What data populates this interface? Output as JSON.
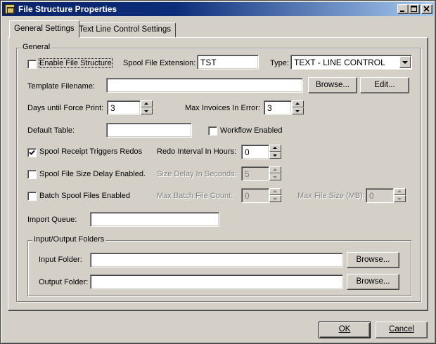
{
  "window": {
    "title": "File Structure Properties",
    "minimize_label": "_",
    "maximize_label": "□",
    "close_label": "×"
  },
  "tabs": [
    {
      "label": "General Settings",
      "active": true
    },
    {
      "label": "Text Line Control Settings",
      "active": false
    }
  ],
  "general": {
    "group_title": "General",
    "enable_file_structure": {
      "label": "Enable File Structure",
      "checked": false
    },
    "spool_file_extension": {
      "label": "Spool File Extension:",
      "value": "TST"
    },
    "type": {
      "label": "Type:",
      "value": "TEXT - LINE CONTROL"
    },
    "template_filename": {
      "label": "Template Filename:",
      "value": ""
    },
    "browse_label": "Browse...",
    "edit_label": "Edit...",
    "days_until_force_print": {
      "label": "Days until Force Print:",
      "value": "3"
    },
    "max_invoices_in_error": {
      "label": "Max Invoices In Error:",
      "value": "3"
    },
    "default_table": {
      "label": "Default Table:",
      "value": ""
    },
    "workflow_enabled": {
      "label": "Workflow Enabled",
      "checked": false
    },
    "spool_receipt_triggers_redos": {
      "label": "Spool Receipt Triggers Redos",
      "checked": true
    },
    "redo_interval_in_hours": {
      "label": "Redo Interval In Hours:",
      "value": "0"
    },
    "spool_file_size_delay_enabled": {
      "label": "Spool File Size Delay Enabled.",
      "checked": false
    },
    "size_delay_in_seconds": {
      "label": "Size Delay In Seconds:",
      "value": "5"
    },
    "batch_spool_files_enabled": {
      "label": "Batch Spool Files Enabled",
      "checked": false
    },
    "max_batch_file_count": {
      "label": "Max Batch File Count:",
      "value": "0"
    },
    "max_file_size_mb": {
      "label": "Max File Size (MB):",
      "value": "0"
    },
    "import_queue": {
      "label": "Import Queue:",
      "value": ""
    }
  },
  "io_folders": {
    "group_title": "Input/Output Folders",
    "input_folder": {
      "label": "Input Folder:",
      "value": ""
    },
    "output_folder": {
      "label": "Output Folder:",
      "value": ""
    },
    "browse_label": "Browse..."
  },
  "footer": {
    "ok_label": "OK",
    "cancel_label": "Cancel"
  }
}
